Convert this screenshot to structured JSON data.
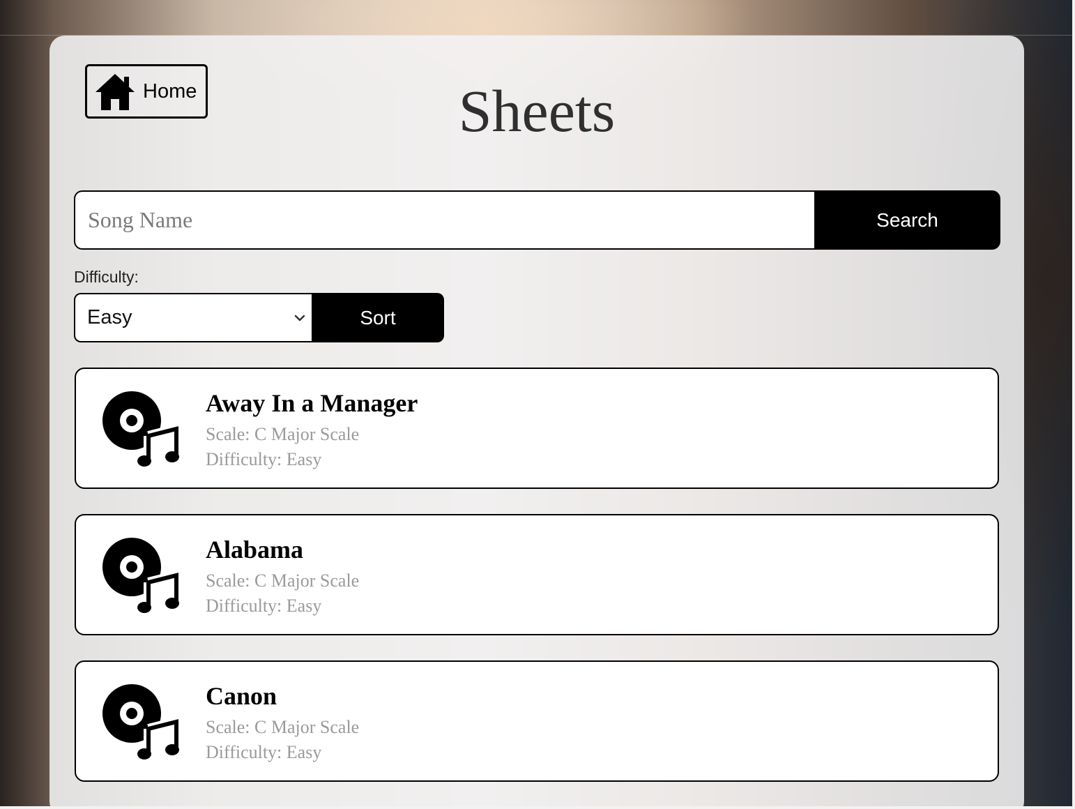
{
  "nav": {
    "home_label": "Home"
  },
  "page": {
    "title": "Sheets"
  },
  "search": {
    "placeholder": "Song Name",
    "value": "",
    "button_label": "Search"
  },
  "filter": {
    "difficulty_label": "Difficulty:",
    "selected": "Easy",
    "sort_label": "Sort"
  },
  "songs": [
    {
      "title": "Away In a Manager",
      "scale": "Scale: C Major Scale",
      "difficulty": "Difficulty: Easy",
      "icon": "music-disc-icon"
    },
    {
      "title": "Alabama",
      "scale": "Scale: C Major Scale",
      "difficulty": "Difficulty: Easy",
      "icon": "music-disc-icon"
    },
    {
      "title": "Canon",
      "scale": "Scale: C Major Scale",
      "difficulty": "Difficulty: Easy",
      "icon": "music-disc-icon"
    }
  ],
  "colors": {
    "accent": "#000000",
    "muted_text": "#9a9a9a",
    "title_text": "#2f2f2f"
  }
}
